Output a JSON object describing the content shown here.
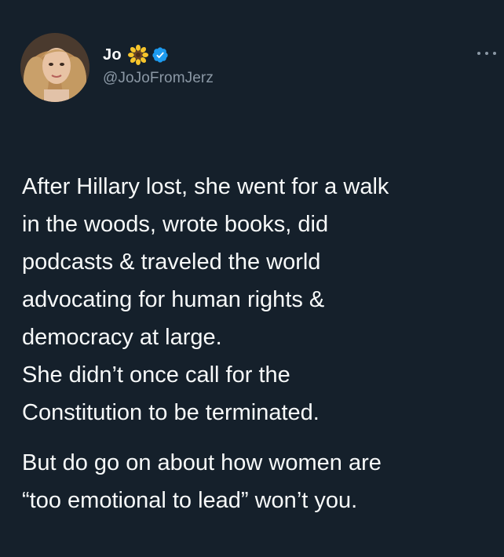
{
  "tweet": {
    "author": {
      "display_name": "Jo",
      "handle": "@JoJoFromJerz",
      "emoji_icon": "sunflower-icon",
      "verified_icon": "verified-badge-icon"
    },
    "more_icon": "more-options-icon",
    "paragraphs": [
      "After Hillary lost, she went for a walk\nin the woods, wrote books, did\npodcasts & traveled the world\nadvocating for human rights &\ndemocracy at large.\nShe didn’t once call for the\nConstitution to be terminated.",
      "But do go on about how women are\n“too emotional to lead” won’t you."
    ]
  },
  "colors": {
    "background": "#15202b",
    "text": "#f7f9f9",
    "secondary_text": "#8b98a5",
    "verified": "#1d9bf0",
    "sunflower_petals": "#f6c42b",
    "sunflower_center": "#6b4226"
  }
}
